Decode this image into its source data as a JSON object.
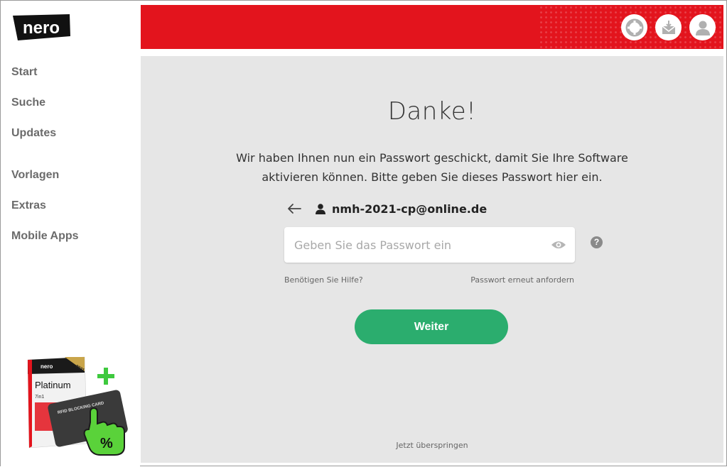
{
  "brand": {
    "logo_text": "nero",
    "accent_color": "#e3141d",
    "button_color": "#2bad6e"
  },
  "sidebar": {
    "items": [
      {
        "label": "Start"
      },
      {
        "label": "Suche"
      },
      {
        "label": "Updates"
      },
      {
        "label": "Vorlagen"
      },
      {
        "label": "Extras"
      },
      {
        "label": "Mobile Apps"
      }
    ],
    "promo": {
      "box_title": "Platinum",
      "box_subtitle": "7in1",
      "year": "2021",
      "card_text": "RFID BLOCKING CARD",
      "badge": "%"
    }
  },
  "header": {
    "icons": [
      "support-icon",
      "download-messages-icon",
      "account-icon"
    ]
  },
  "main": {
    "title": "Danke!",
    "description": "Wir haben Ihnen nun ein Passwort geschickt, damit Sie Ihre Software aktivieren können. Bitte geben Sie dieses Passwort hier ein.",
    "email": "nmh-2021-cp@online.de",
    "password": {
      "placeholder": "Geben Sie das Passwort ein",
      "value": ""
    },
    "help_symbol": "?",
    "link_help": "Benötigen Sie Hilfe?",
    "link_resend": "Passwort erneut anfordern",
    "submit_label": "Weiter",
    "skip_label": "Jetzt überspringen"
  }
}
